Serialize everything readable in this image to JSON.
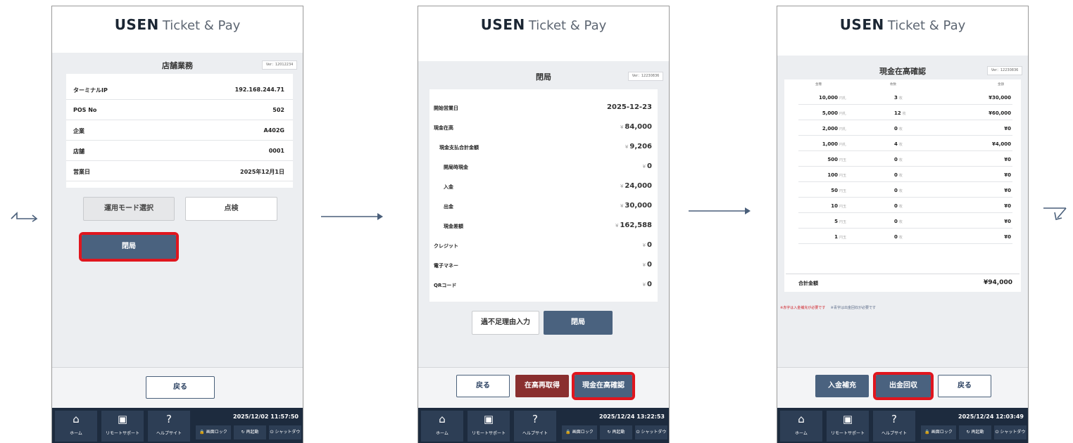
{
  "brand": {
    "bold": "USEN",
    "light": "Ticket & Pay"
  },
  "screen1": {
    "title": "店舗業務",
    "version": "Ver：12012234",
    "rows": [
      {
        "key": "ターミナルIP",
        "value": "192.168.244.71"
      },
      {
        "key": "POS No",
        "value": "502"
      },
      {
        "key": "企業",
        "value": "A402G"
      },
      {
        "key": "店舗",
        "value": "0001"
      },
      {
        "key": "営業日",
        "value": "2025年12月1日"
      }
    ],
    "mode_select_button": "運用モード選択",
    "inspection_button": "点検",
    "close_button": "閉局",
    "back_button": "戻る",
    "clock": "2025/12/02 11:57:50"
  },
  "screen2": {
    "title": "閉局",
    "version": "Ver：12230836",
    "rows": [
      {
        "key": "開始営業日",
        "value": "2025-12-23",
        "yen": false
      },
      {
        "key": "現金在高",
        "value": "84,000",
        "yen": true
      },
      {
        "key": "現金支払合計金額",
        "value": "9,206",
        "yen": true
      },
      {
        "key": "開局時現金",
        "value": "0",
        "yen": true
      },
      {
        "key": "入金",
        "value": "24,000",
        "yen": true
      },
      {
        "key": "出金",
        "value": "30,000",
        "yen": true
      },
      {
        "key": "現金差額",
        "value": "162,588",
        "yen": true
      },
      {
        "key": "クレジット",
        "value": "0",
        "yen": true
      },
      {
        "key": "電子マネー",
        "value": "0",
        "yen": true
      },
      {
        "key": "QRコード",
        "value": "0",
        "yen": true
      }
    ],
    "reason_button": "過不足理由入力",
    "close_button": "閉局",
    "back_button": "戻る",
    "reacquire_button": "在高再取得",
    "cash_check_button": "現金在高確認",
    "clock": "2025/12/24 13:22:53"
  },
  "screen3": {
    "title": "現金在高確認",
    "version": "Ver：12230836",
    "headers": [
      "金種",
      "枚数",
      "金額"
    ],
    "rows": [
      {
        "denom": "10,000",
        "unit": "円札",
        "count": "3",
        "amount": "¥30,000"
      },
      {
        "denom": "5,000",
        "unit": "円札",
        "count": "12",
        "amount": "¥60,000"
      },
      {
        "denom": "2,000",
        "unit": "円札",
        "count": "0",
        "amount": "¥0"
      },
      {
        "denom": "1,000",
        "unit": "円札",
        "count": "4",
        "amount": "¥4,000"
      },
      {
        "denom": "500",
        "unit": "円玉",
        "count": "0",
        "amount": "¥0"
      },
      {
        "denom": "100",
        "unit": "円玉",
        "count": "0",
        "amount": "¥0"
      },
      {
        "denom": "50",
        "unit": "円玉",
        "count": "0",
        "amount": "¥0"
      },
      {
        "denom": "10",
        "unit": "円玉",
        "count": "0",
        "amount": "¥0"
      },
      {
        "denom": "5",
        "unit": "円玉",
        "count": "0",
        "amount": "¥0"
      },
      {
        "denom": "1",
        "unit": "円玉",
        "count": "0",
        "amount": "¥0"
      }
    ],
    "count_unit": "枚",
    "total_label": "合計金額",
    "total_value": "¥94,000",
    "note_red": "※赤字は入金補充が必要です",
    "note_blue": "※青字は出金回収が必要です",
    "deposit_button": "入金補充",
    "withdraw_button": "出金回収",
    "back_button": "戻る",
    "clock": "2025/12/24 12:03:49"
  },
  "taskbar": {
    "home": "ホーム",
    "remote": "リモートサポート",
    "help": "ヘルプサイト",
    "lock": "画面ロック",
    "restart": "再起動",
    "shutdown": "シャットダウン"
  },
  "yen_sign": "¥",
  "colors": {
    "highlight": "#e0161e",
    "primary": "#4a627f",
    "danger": "#8a2f2f",
    "taskbar": "#1d2b3e"
  }
}
